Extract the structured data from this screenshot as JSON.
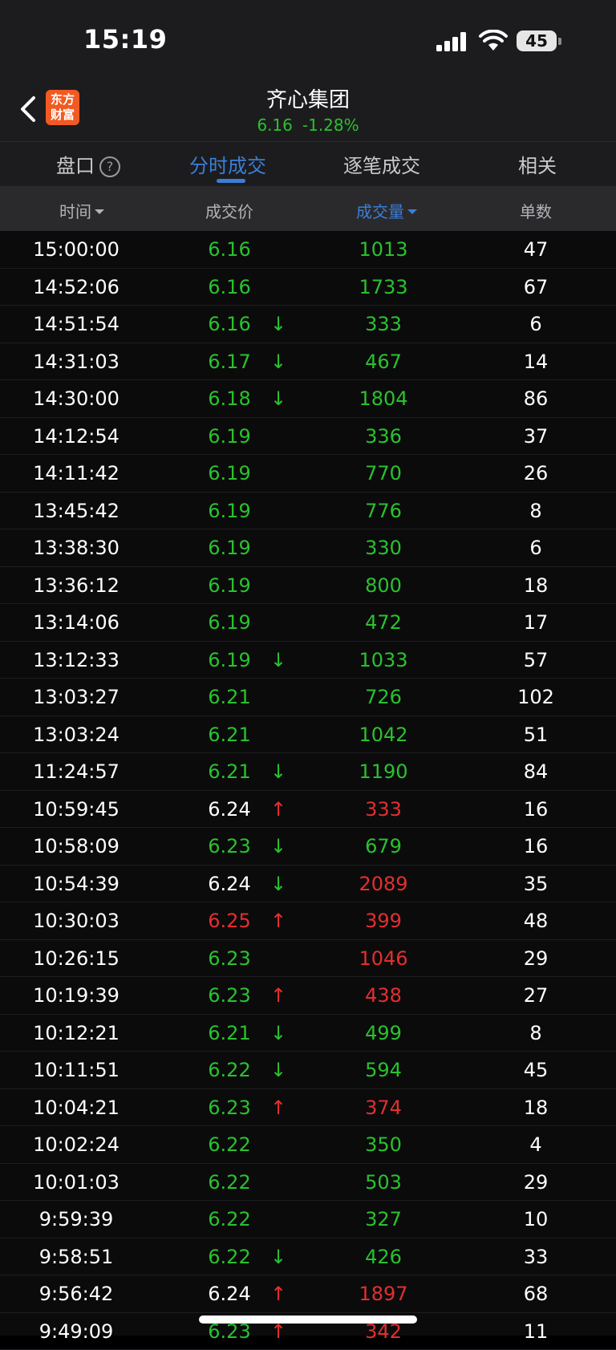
{
  "status_bar": {
    "time": "15:19",
    "battery": "45"
  },
  "header": {
    "title": "齐心集团",
    "price": "6.16",
    "change": "-1.28%",
    "logo_line1": "东方",
    "logo_line2": "财富"
  },
  "tabs": [
    {
      "label": "盘口",
      "help": "?"
    },
    {
      "label": "分时成交"
    },
    {
      "label": "逐笔成交"
    },
    {
      "label": "相关"
    }
  ],
  "columns": {
    "time": "时间",
    "price": "成交价",
    "volume": "成交量",
    "count": "单数"
  },
  "colors": {
    "green": "#29c22d",
    "red": "#e52e2e",
    "accent_blue": "#3a7fd8"
  },
  "trades": [
    {
      "time": "15:00:00",
      "price": "6.16",
      "price_color": "green",
      "arrow": "",
      "arrow_color": "",
      "volume": "1013",
      "volume_color": "green",
      "count": "47"
    },
    {
      "time": "14:52:06",
      "price": "6.16",
      "price_color": "green",
      "arrow": "",
      "arrow_color": "",
      "volume": "1733",
      "volume_color": "green",
      "count": "67"
    },
    {
      "time": "14:51:54",
      "price": "6.16",
      "price_color": "green",
      "arrow": "↓",
      "arrow_color": "green",
      "volume": "333",
      "volume_color": "green",
      "count": "6"
    },
    {
      "time": "14:31:03",
      "price": "6.17",
      "price_color": "green",
      "arrow": "↓",
      "arrow_color": "green",
      "volume": "467",
      "volume_color": "green",
      "count": "14"
    },
    {
      "time": "14:30:00",
      "price": "6.18",
      "price_color": "green",
      "arrow": "↓",
      "arrow_color": "green",
      "volume": "1804",
      "volume_color": "green",
      "count": "86"
    },
    {
      "time": "14:12:54",
      "price": "6.19",
      "price_color": "green",
      "arrow": "",
      "arrow_color": "",
      "volume": "336",
      "volume_color": "green",
      "count": "37"
    },
    {
      "time": "14:11:42",
      "price": "6.19",
      "price_color": "green",
      "arrow": "",
      "arrow_color": "",
      "volume": "770",
      "volume_color": "green",
      "count": "26"
    },
    {
      "time": "13:45:42",
      "price": "6.19",
      "price_color": "green",
      "arrow": "",
      "arrow_color": "",
      "volume": "776",
      "volume_color": "green",
      "count": "8"
    },
    {
      "time": "13:38:30",
      "price": "6.19",
      "price_color": "green",
      "arrow": "",
      "arrow_color": "",
      "volume": "330",
      "volume_color": "green",
      "count": "6"
    },
    {
      "time": "13:36:12",
      "price": "6.19",
      "price_color": "green",
      "arrow": "",
      "arrow_color": "",
      "volume": "800",
      "volume_color": "green",
      "count": "18"
    },
    {
      "time": "13:14:06",
      "price": "6.19",
      "price_color": "green",
      "arrow": "",
      "arrow_color": "",
      "volume": "472",
      "volume_color": "green",
      "count": "17"
    },
    {
      "time": "13:12:33",
      "price": "6.19",
      "price_color": "green",
      "arrow": "↓",
      "arrow_color": "green",
      "volume": "1033",
      "volume_color": "green",
      "count": "57"
    },
    {
      "time": "13:03:27",
      "price": "6.21",
      "price_color": "green",
      "arrow": "",
      "arrow_color": "",
      "volume": "726",
      "volume_color": "green",
      "count": "102"
    },
    {
      "time": "13:03:24",
      "price": "6.21",
      "price_color": "green",
      "arrow": "",
      "arrow_color": "",
      "volume": "1042",
      "volume_color": "green",
      "count": "51"
    },
    {
      "time": "11:24:57",
      "price": "6.21",
      "price_color": "green",
      "arrow": "↓",
      "arrow_color": "green",
      "volume": "1190",
      "volume_color": "green",
      "count": "84"
    },
    {
      "time": "10:59:45",
      "price": "6.24",
      "price_color": "white",
      "arrow": "↑",
      "arrow_color": "red",
      "volume": "333",
      "volume_color": "red",
      "count": "16"
    },
    {
      "time": "10:58:09",
      "price": "6.23",
      "price_color": "green",
      "arrow": "↓",
      "arrow_color": "green",
      "volume": "679",
      "volume_color": "green",
      "count": "16"
    },
    {
      "time": "10:54:39",
      "price": "6.24",
      "price_color": "white",
      "arrow": "↓",
      "arrow_color": "green",
      "volume": "2089",
      "volume_color": "red",
      "count": "35"
    },
    {
      "time": "10:30:03",
      "price": "6.25",
      "price_color": "red",
      "arrow": "↑",
      "arrow_color": "red",
      "volume": "399",
      "volume_color": "red",
      "count": "48"
    },
    {
      "time": "10:26:15",
      "price": "6.23",
      "price_color": "green",
      "arrow": "",
      "arrow_color": "",
      "volume": "1046",
      "volume_color": "red",
      "count": "29"
    },
    {
      "time": "10:19:39",
      "price": "6.23",
      "price_color": "green",
      "arrow": "↑",
      "arrow_color": "red",
      "volume": "438",
      "volume_color": "red",
      "count": "27"
    },
    {
      "time": "10:12:21",
      "price": "6.21",
      "price_color": "green",
      "arrow": "↓",
      "arrow_color": "green",
      "volume": "499",
      "volume_color": "green",
      "count": "8"
    },
    {
      "time": "10:11:51",
      "price": "6.22",
      "price_color": "green",
      "arrow": "↓",
      "arrow_color": "green",
      "volume": "594",
      "volume_color": "green",
      "count": "45"
    },
    {
      "time": "10:04:21",
      "price": "6.23",
      "price_color": "green",
      "arrow": "↑",
      "arrow_color": "red",
      "volume": "374",
      "volume_color": "red",
      "count": "18"
    },
    {
      "time": "10:02:24",
      "price": "6.22",
      "price_color": "green",
      "arrow": "",
      "arrow_color": "",
      "volume": "350",
      "volume_color": "green",
      "count": "4"
    },
    {
      "time": "10:01:03",
      "price": "6.22",
      "price_color": "green",
      "arrow": "",
      "arrow_color": "",
      "volume": "503",
      "volume_color": "green",
      "count": "29"
    },
    {
      "time": "9:59:39",
      "price": "6.22",
      "price_color": "green",
      "arrow": "",
      "arrow_color": "",
      "volume": "327",
      "volume_color": "green",
      "count": "10"
    },
    {
      "time": "9:58:51",
      "price": "6.22",
      "price_color": "green",
      "arrow": "↓",
      "arrow_color": "green",
      "volume": "426",
      "volume_color": "green",
      "count": "33"
    },
    {
      "time": "9:56:42",
      "price": "6.24",
      "price_color": "white",
      "arrow": "↑",
      "arrow_color": "red",
      "volume": "1897",
      "volume_color": "red",
      "count": "68"
    },
    {
      "time": "9:49:09",
      "price": "6.23",
      "price_color": "green",
      "arrow": "↑",
      "arrow_color": "red",
      "volume": "342",
      "volume_color": "red",
      "count": "11"
    }
  ]
}
